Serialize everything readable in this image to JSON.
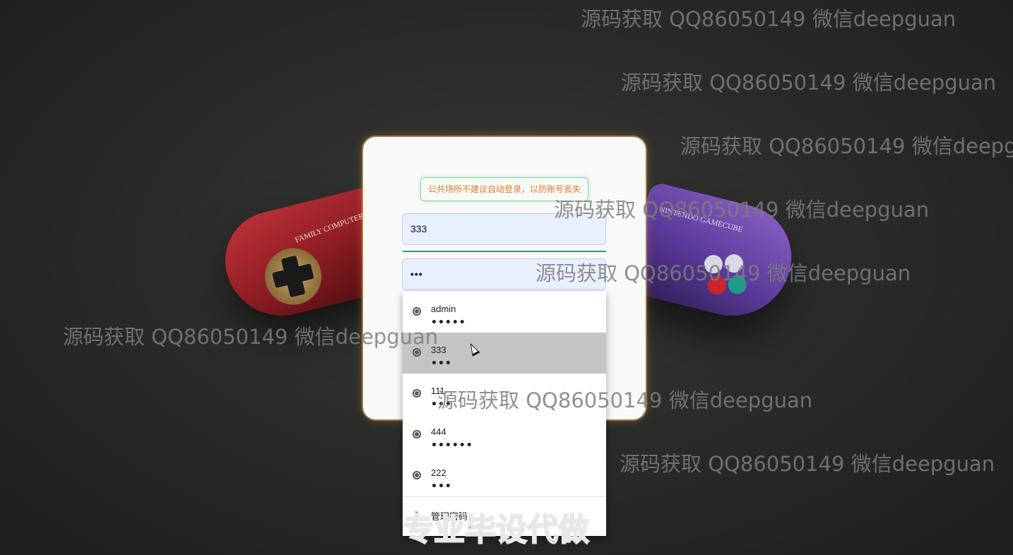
{
  "background": {
    "left_controller_brand": "FAMILY COMPUTER",
    "right_controller_brand": "NINTENDO GAMECUBE"
  },
  "login": {
    "notice": "公共场所不建议自动登录，以防账号丢失",
    "username_value": "333",
    "password_value": "•••"
  },
  "autofill": {
    "items": [
      {
        "user": "admin",
        "pass": "•••••"
      },
      {
        "user": "333",
        "pass": "•••"
      },
      {
        "user": "111",
        "pass": "•••"
      },
      {
        "user": "444",
        "pass": "••••••"
      },
      {
        "user": "222",
        "pass": "•••"
      }
    ],
    "manage_label": "管理密码..."
  },
  "watermarks": {
    "text": "源码获取 QQ86050149 微信deepguan",
    "banner": "专业毕设代做"
  },
  "colors": {
    "notice_text": "#e07a2e",
    "notice_border": "#7fd4a6",
    "field_bg": "#e8f0fe",
    "selected_row": "#c4c4c4"
  }
}
